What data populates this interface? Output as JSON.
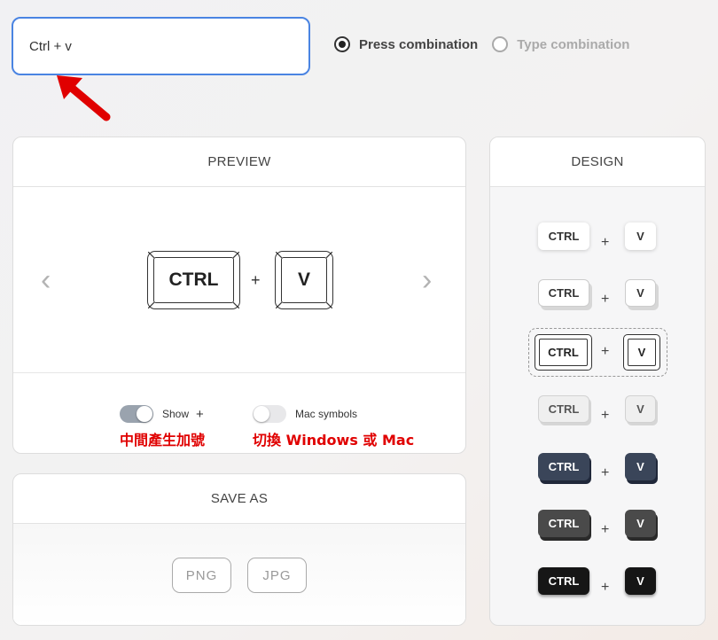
{
  "input": {
    "value": "Ctrl + v"
  },
  "mode": {
    "press_label": "Press combination",
    "type_label": "Type combination",
    "selected": "press"
  },
  "preview": {
    "title": "PREVIEW",
    "keys": [
      "CTRL",
      "V"
    ],
    "plus": "+",
    "prev": "‹",
    "next": "›",
    "show_plus_label": "Show",
    "show_plus_symbol": "+",
    "show_plus_on": true,
    "mac_symbols_label": "Mac symbols",
    "mac_symbols_on": false,
    "note_plus": "中間產生加號",
    "note_mac": "切換 Windows 或 Mac"
  },
  "save_as": {
    "title": "SAVE AS",
    "formats": [
      "PNG",
      "JPG"
    ]
  },
  "design": {
    "title": "DESIGN",
    "key_ctrl": "CTRL",
    "key_v": "V",
    "plus": "+",
    "selected_style": 3
  },
  "colors": {
    "accent": "#4a84e2",
    "annotation": "#e00000",
    "dark_blue_key": "#3a4559",
    "gray_key": "#4a4a4a",
    "black_key": "#161616"
  }
}
